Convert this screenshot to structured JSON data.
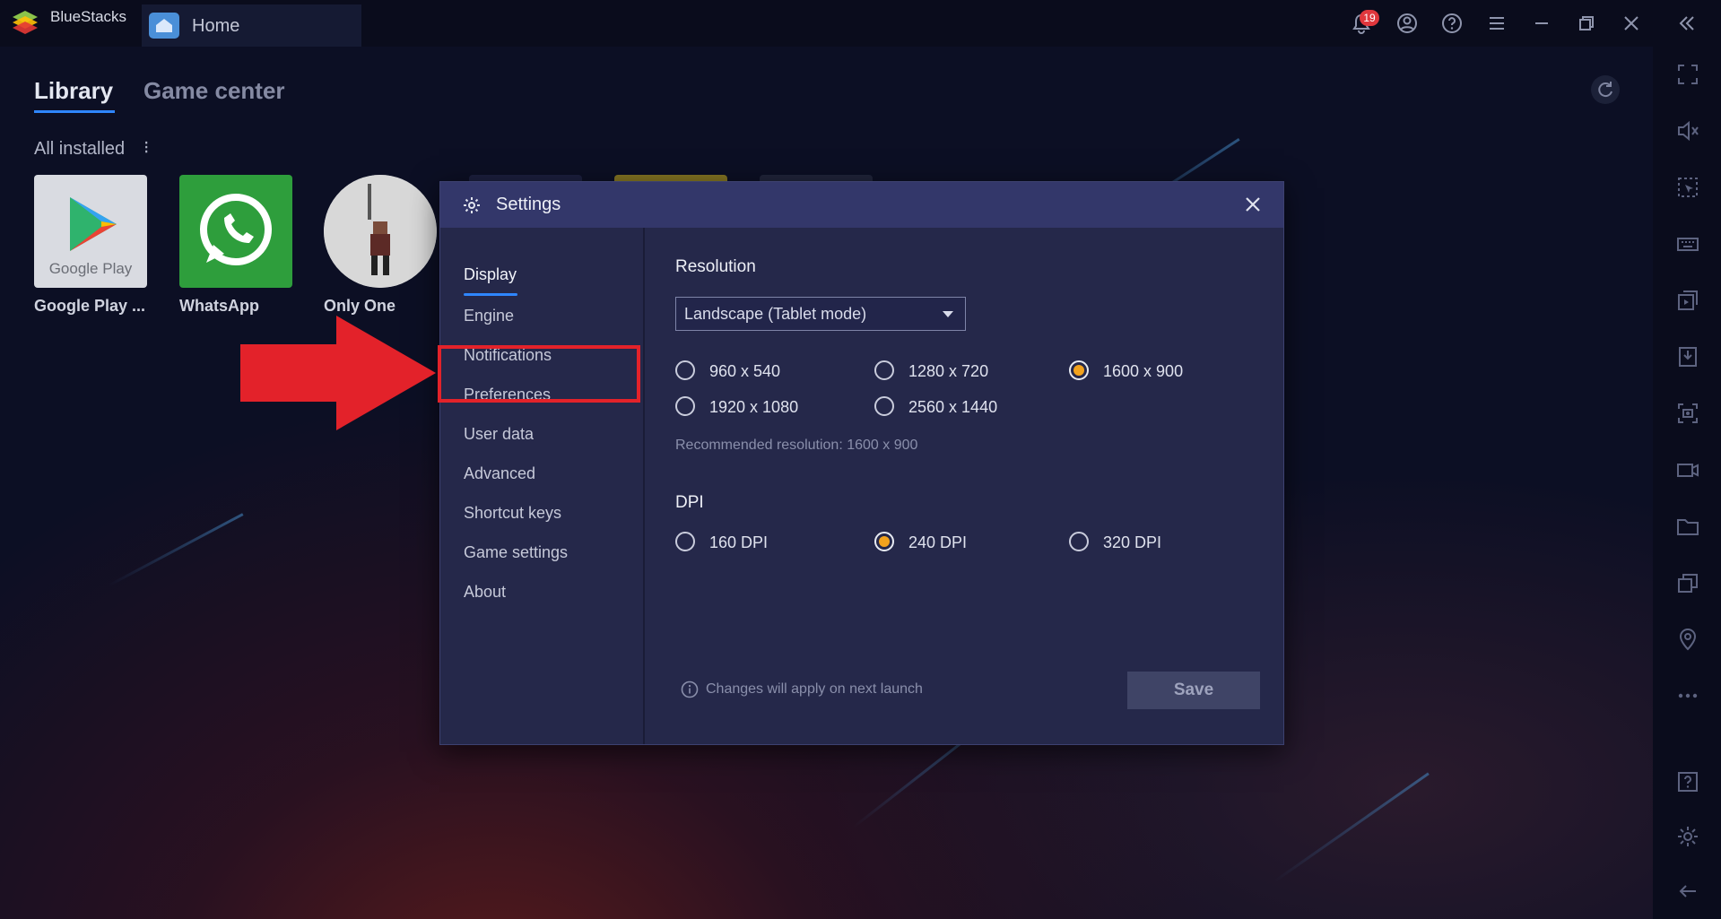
{
  "window": {
    "app_name": "BlueStacks",
    "tab_title": "Home",
    "notification_count": "19"
  },
  "library": {
    "tabs": [
      "Library",
      "Game center"
    ],
    "section_title": "All installed",
    "section_menu": "⁝",
    "apps": [
      {
        "label": "Google Play ...",
        "icon": "google-play-icon",
        "tile_text": "Google Play"
      },
      {
        "label": "WhatsApp",
        "icon": "whatsapp-icon"
      },
      {
        "label": "Only One",
        "icon": "only-one-game-icon"
      }
    ]
  },
  "settings": {
    "title": "Settings",
    "nav": [
      "Display",
      "Engine",
      "Notifications",
      "Preferences",
      "User data",
      "Advanced",
      "Shortcut keys",
      "Game settings",
      "About"
    ],
    "active_nav": "Display",
    "resolution_label": "Resolution",
    "resolution_mode": "Landscape (Tablet mode)",
    "resolutions": [
      "960 x 540",
      "1280 x 720",
      "1600 x 900",
      "1920 x 1080",
      "2560 x 1440"
    ],
    "selected_resolution": "1600 x 900",
    "recommended_text": "Recommended resolution: 1600 x 900",
    "dpi_label": "DPI",
    "dpi_options": [
      "160 DPI",
      "240 DPI",
      "320 DPI"
    ],
    "selected_dpi": "240 DPI",
    "footer_note": "Changes will apply on next launch",
    "save_label": "Save"
  },
  "annotation": {
    "highlight_color": "#e3222a",
    "highlighted_item": "Notifications"
  },
  "colors": {
    "accent_blue": "#2f86ff",
    "radio_selected": "#f2a21d",
    "dialog_bg": "#25284a"
  }
}
